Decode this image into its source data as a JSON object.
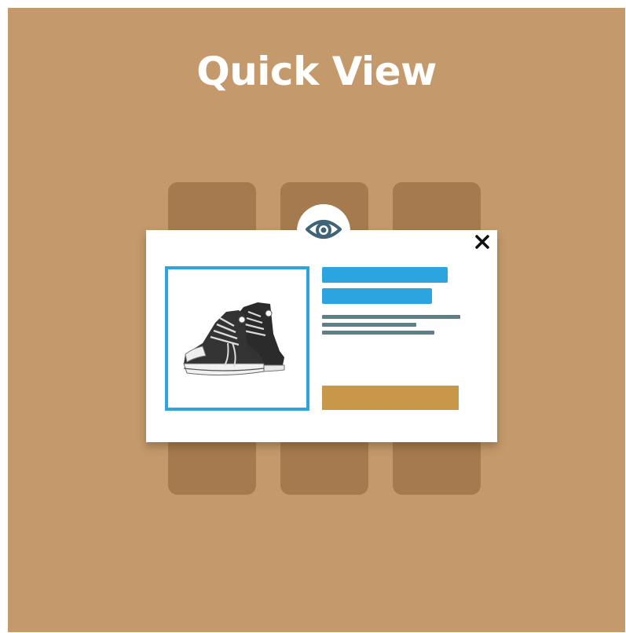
{
  "header": {
    "title": "Quick View"
  },
  "colors": {
    "background": "#c49a6c",
    "card": "#a57a4f",
    "accent_blue": "#2ba4e0",
    "text_line": "#5c7f8c",
    "button": "#c9974a",
    "eye_icon": "#3f6475"
  },
  "icons": {
    "eye": "eye-icon",
    "close": "close-icon",
    "product": "sneakers-illustration"
  }
}
